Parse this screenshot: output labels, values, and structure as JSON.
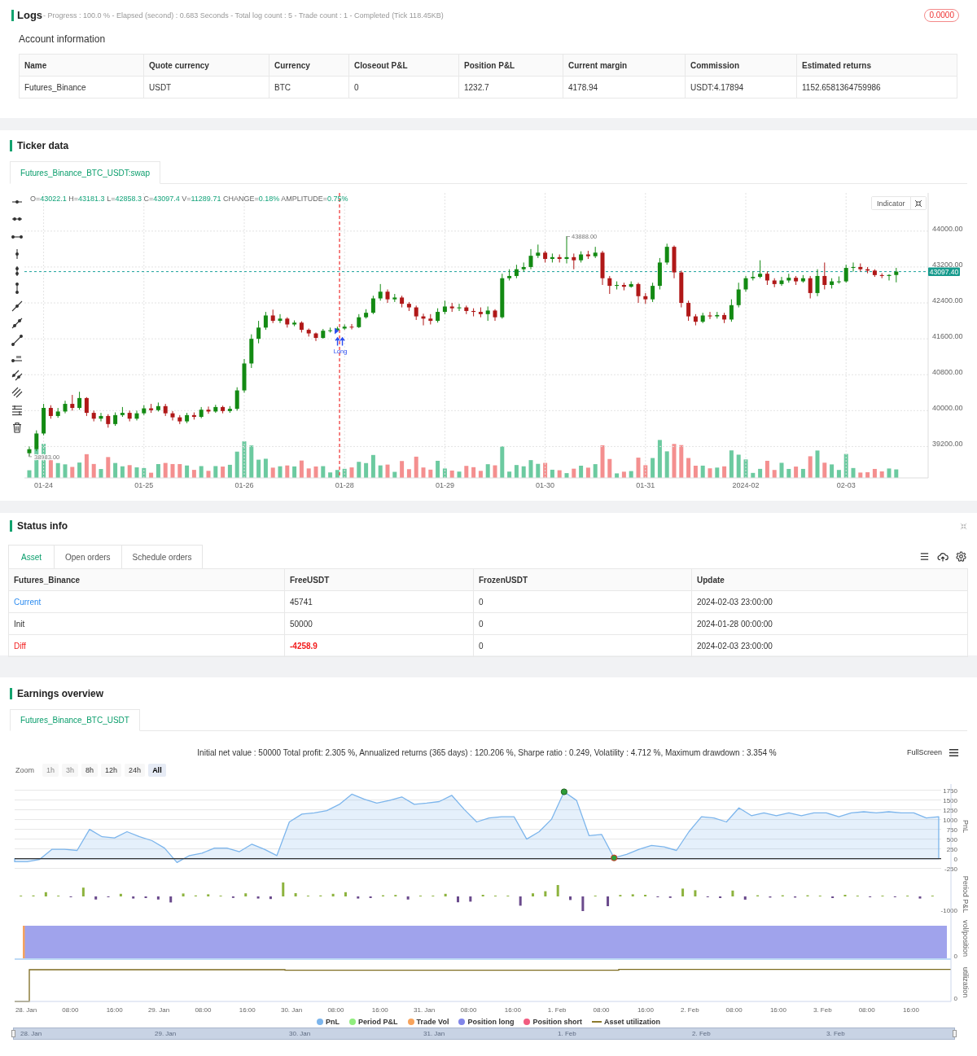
{
  "logs": {
    "title": "Logs",
    "summary": "- Progress : 100.0 % - Elapsed (second) : 0.683 Seconds - Total log count : 5 - Trade count : 1 - Completed (Tick 118.45KB)",
    "badge": "0.0000"
  },
  "account_information": {
    "title": "Account information",
    "columns": [
      "Name",
      "Quote currency",
      "Currency",
      "Closeout P&L",
      "Position P&L",
      "Current margin",
      "Commission",
      "Estimated returns"
    ],
    "rows": [
      [
        "Futures_Binance",
        "USDT",
        "BTC",
        "0",
        "1232.7",
        "4178.94",
        "USDT:4.17894",
        "1152.6581364759986"
      ]
    ]
  },
  "ticker_data": {
    "title": "Ticker data",
    "tabs": [
      {
        "label": "Futures_Binance_BTC_USDT:swap",
        "selected": true
      }
    ],
    "ohlc": [
      {
        "label": "O=",
        "value": "43022.1"
      },
      {
        "label": "H=",
        "value": "43181.3"
      },
      {
        "label": "L=",
        "value": "42858.3"
      },
      {
        "label": "C=",
        "value": "43097.4"
      },
      {
        "label": "V=",
        "value": "11289.71"
      },
      {
        "label": "CHANGE=",
        "value": "0.18%"
      },
      {
        "label": "AMPLITUDE=",
        "value": "0.75%"
      }
    ],
    "indicator_button": "Indicator",
    "last_price": "43097.40",
    "high_label": "43888.00",
    "low_label": "38983.00",
    "chart_data": {
      "type": "candlestick",
      "grid": true,
      "ylim": [
        38500,
        44850
      ],
      "yticks": [
        {
          "value": 44000,
          "label": "44000.00"
        },
        {
          "value": 43200,
          "label": "43200.00"
        },
        {
          "value": 42400,
          "label": "42400.00"
        },
        {
          "value": 41600,
          "label": "41600.00"
        },
        {
          "value": 40800,
          "label": "40800.00"
        },
        {
          "value": 40000,
          "label": "40000.00"
        },
        {
          "value": 39200,
          "label": "39200.00"
        }
      ],
      "categories": [
        null,
        null,
        "01-24",
        null,
        null,
        null,
        null,
        null,
        null,
        null,
        null,
        null,
        null,
        null,
        null,
        null,
        "01-25",
        null,
        null,
        null,
        null,
        null,
        null,
        null,
        null,
        null,
        null,
        null,
        null,
        null,
        "01-26",
        null,
        null,
        null,
        null,
        null,
        null,
        null,
        null,
        null,
        null,
        null,
        null,
        null,
        "01-28",
        null,
        null,
        null,
        null,
        null,
        null,
        null,
        null,
        null,
        null,
        null,
        null,
        null,
        "01-29",
        null,
        null,
        null,
        null,
        null,
        null,
        null,
        null,
        null,
        null,
        null,
        null,
        null,
        "01-30",
        null,
        null,
        null,
        null,
        null,
        null,
        null,
        null,
        null,
        null,
        null,
        null,
        null,
        "01-31",
        null,
        null,
        null,
        null,
        null,
        null,
        null,
        null,
        null,
        null,
        null,
        null,
        null,
        "2024-02",
        null,
        null,
        null,
        null,
        null,
        null,
        null,
        null,
        null,
        null,
        null,
        null,
        null,
        "02-03",
        null,
        null,
        null,
        null,
        null,
        null,
        null
      ],
      "annotations": [
        "Long"
      ],
      "ref_lines": [
        {
          "axis": "y",
          "value": 43097.4
        }
      ],
      "ohlc": [
        [
          39050,
          39200,
          38983,
          39140
        ],
        [
          39140,
          39560,
          39100,
          39490
        ],
        [
          39490,
          40150,
          39450,
          40060
        ],
        [
          40060,
          40120,
          39820,
          39880
        ],
        [
          39880,
          40060,
          39840,
          39980
        ],
        [
          39980,
          40220,
          39940,
          40150
        ],
        [
          40150,
          40350,
          40000,
          40060
        ],
        [
          40060,
          40420,
          40020,
          40280
        ],
        [
          40280,
          40300,
          39880,
          39950
        ],
        [
          39950,
          40000,
          39760,
          39820
        ],
        [
          39820,
          39950,
          39760,
          39880
        ],
        [
          39880,
          39920,
          39620,
          39700
        ],
        [
          39700,
          39960,
          39660,
          39900
        ],
        [
          39900,
          40080,
          39860,
          39950
        ],
        [
          39950,
          40000,
          39760,
          39820
        ],
        [
          39820,
          40000,
          39780,
          39940
        ],
        [
          39940,
          40120,
          39900,
          40050
        ],
        [
          40050,
          40150,
          39950,
          40010
        ],
        [
          40010,
          40180,
          39980,
          40100
        ],
        [
          40100,
          40150,
          39880,
          39940
        ],
        [
          39940,
          39990,
          39780,
          39850
        ],
        [
          39850,
          39900,
          39700,
          39760
        ],
        [
          39760,
          39950,
          39720,
          39900
        ],
        [
          39900,
          39960,
          39800,
          39860
        ],
        [
          39860,
          40080,
          39830,
          40020
        ],
        [
          40020,
          40090,
          39930,
          39980
        ],
        [
          39980,
          40130,
          39950,
          40080
        ],
        [
          40080,
          40110,
          39940,
          39990
        ],
        [
          39990,
          40100,
          39950,
          40040
        ],
        [
          40040,
          40520,
          40000,
          40450
        ],
        [
          40450,
          41150,
          40400,
          41050
        ],
        [
          41050,
          41700,
          40950,
          41600
        ],
        [
          41600,
          42000,
          41500,
          41850
        ],
        [
          41850,
          42200,
          41800,
          42120
        ],
        [
          42120,
          42250,
          41950,
          42000
        ],
        [
          42000,
          42150,
          41950,
          42050
        ],
        [
          42050,
          42080,
          41850,
          41920
        ],
        [
          41920,
          42010,
          41880,
          41960
        ],
        [
          41960,
          41990,
          41740,
          41800
        ],
        [
          41800,
          41830,
          41650,
          41720
        ],
        [
          41720,
          41740,
          41550,
          41620
        ],
        [
          41620,
          41820,
          41600,
          41780
        ],
        [
          41780,
          41850,
          41740,
          41790
        ],
        [
          41790,
          41870,
          41770,
          41830
        ],
        [
          41830,
          41920,
          41800,
          41870
        ],
        [
          41870,
          41930,
          41810,
          41860
        ],
        [
          41860,
          42150,
          41840,
          42080
        ],
        [
          42080,
          42260,
          42050,
          42180
        ],
        [
          42180,
          42560,
          42150,
          42500
        ],
        [
          42500,
          42820,
          42450,
          42650
        ],
        [
          42650,
          42700,
          42400,
          42480
        ],
        [
          42480,
          42600,
          42420,
          42520
        ],
        [
          42520,
          42560,
          42300,
          42380
        ],
        [
          42380,
          42420,
          42220,
          42300
        ],
        [
          42300,
          42340,
          42020,
          42100
        ],
        [
          42100,
          42160,
          41900,
          42050
        ],
        [
          42050,
          42150,
          41920,
          42000
        ],
        [
          42000,
          42280,
          41960,
          42200
        ],
        [
          42200,
          42450,
          42150,
          42320
        ],
        [
          42320,
          42400,
          42200,
          42280
        ],
        [
          42280,
          42380,
          42220,
          42300
        ],
        [
          42300,
          42340,
          42150,
          42220
        ],
        [
          42220,
          42280,
          42100,
          42200
        ],
        [
          42200,
          42300,
          42080,
          42150
        ],
        [
          42150,
          42320,
          42000,
          42230
        ],
        [
          42230,
          42260,
          42000,
          42080
        ],
        [
          42080,
          43050,
          42050,
          42950
        ],
        [
          42950,
          43150,
          42900,
          43000
        ],
        [
          43000,
          43250,
          42950,
          43150
        ],
        [
          43150,
          43300,
          43100,
          43200
        ],
        [
          43200,
          43600,
          43150,
          43450
        ],
        [
          43450,
          43700,
          43400,
          43520
        ],
        [
          43520,
          43560,
          43300,
          43380
        ],
        [
          43380,
          43500,
          43300,
          43420
        ],
        [
          43420,
          43480,
          43300,
          43380
        ],
        [
          43380,
          43888,
          43280,
          43420
        ],
        [
          43420,
          43500,
          43150,
          43350
        ],
        [
          43350,
          43550,
          43300,
          43480
        ],
        [
          43480,
          43560,
          43380,
          43440
        ],
        [
          43440,
          43650,
          43400,
          43520
        ],
        [
          43520,
          43560,
          42800,
          42950
        ],
        [
          42950,
          43000,
          42600,
          42780
        ],
        [
          42780,
          42880,
          42700,
          42800
        ],
        [
          42800,
          42850,
          42680,
          42760
        ],
        [
          42760,
          42880,
          42740,
          42820
        ],
        [
          42820,
          42850,
          42400,
          42550
        ],
        [
          42550,
          42620,
          42380,
          42480
        ],
        [
          42480,
          42850,
          42420,
          42780
        ],
        [
          42780,
          43400,
          42700,
          43300
        ],
        [
          43300,
          43720,
          43250,
          43650
        ],
        [
          43650,
          43680,
          42950,
          43080
        ],
        [
          43080,
          43120,
          42300,
          42400
        ],
        [
          42400,
          42450,
          42000,
          42100
        ],
        [
          42100,
          42150,
          41900,
          41980
        ],
        [
          41980,
          42180,
          41950,
          42120
        ],
        [
          42120,
          42200,
          42040,
          42100
        ],
        [
          42100,
          42200,
          42050,
          42130
        ],
        [
          42130,
          42180,
          41950,
          42030
        ],
        [
          42030,
          42480,
          41980,
          42350
        ],
        [
          42350,
          42850,
          42300,
          42700
        ],
        [
          42700,
          43000,
          42650,
          42950
        ],
        [
          42950,
          43100,
          42900,
          42980
        ],
        [
          42980,
          43350,
          42950,
          43050
        ],
        [
          43050,
          43100,
          42800,
          42900
        ],
        [
          42900,
          42950,
          42750,
          42820
        ],
        [
          42820,
          42980,
          42780,
          42900
        ],
        [
          42900,
          43050,
          42850,
          42960
        ],
        [
          42960,
          43000,
          42800,
          42880
        ],
        [
          42880,
          43020,
          42850,
          42950
        ],
        [
          42950,
          43000,
          42500,
          42620
        ],
        [
          42620,
          43150,
          42550,
          43000
        ],
        [
          43000,
          43300,
          42700,
          42800
        ],
        [
          42800,
          42950,
          42720,
          42880
        ],
        [
          42880,
          42990,
          42830,
          42880
        ],
        [
          42880,
          43250,
          42850,
          43180
        ],
        [
          43180,
          43300,
          43100,
          43200
        ],
        [
          43200,
          43280,
          43100,
          43150
        ],
        [
          43150,
          43200,
          43060,
          43120
        ],
        [
          43120,
          43150,
          42980,
          43020
        ],
        [
          43020,
          43060,
          42950,
          43000
        ],
        [
          43000,
          43040,
          42900,
          43022.1
        ],
        [
          43022.1,
          43181.3,
          42858.3,
          43097.4
        ]
      ]
    }
  },
  "status_info": {
    "title": "Status info",
    "tabs": [
      {
        "label": "Asset",
        "selected": true
      },
      {
        "label": "Open orders",
        "selected": false
      },
      {
        "label": "Schedule orders",
        "selected": false
      }
    ],
    "columns": [
      "Futures_Binance",
      "FreeUSDT",
      "FrozenUSDT",
      "Update"
    ],
    "rows": [
      {
        "kind": "link",
        "cells": [
          "Current",
          "45741",
          "0",
          "2024-02-03 23:00:00"
        ]
      },
      {
        "kind": "plain",
        "cells": [
          "Init",
          "50000",
          "0",
          "2024-01-28 00:00:00"
        ]
      },
      {
        "kind": "negative",
        "cells": [
          "Diff",
          "-4258.9",
          "0",
          "2024-02-03 23:00:00"
        ]
      }
    ]
  },
  "earnings_overview": {
    "title": "Earnings overview",
    "tabs": [
      {
        "label": "Futures_Binance_BTC_USDT",
        "selected": true
      }
    ],
    "summary": "Initial net value : 50000 Total profit: 2.305 %, Annualized returns (365 days) : 120.206 %, Sharpe ratio : 0.249, Volatility : 4.712 %, Maximum drawdown : 3.354 %",
    "fullscreen_button": "FullScreen",
    "zoom_label": "Zoom",
    "zoom_buttons": [
      {
        "label": "1h",
        "selected": false,
        "disabled": true
      },
      {
        "label": "3h",
        "selected": false,
        "disabled": true
      },
      {
        "label": "8h",
        "selected": false,
        "disabled": false
      },
      {
        "label": "12h",
        "selected": false,
        "disabled": false
      },
      {
        "label": "24h",
        "selected": false,
        "disabled": false
      },
      {
        "label": "All",
        "selected": true,
        "disabled": false
      }
    ],
    "chart_data": {
      "type": "area",
      "grid": true,
      "ylabel": "PnL",
      "ylim": [
        -250,
        1750
      ],
      "yticks": [
        -250,
        0,
        250,
        500,
        750,
        1000,
        1250,
        1500,
        1750
      ],
      "series": [
        {
          "name": "PnL",
          "color": "#7cb5ec",
          "values": [
            -80,
            -80,
            -20,
            240,
            240,
            210,
            750,
            560,
            530,
            690,
            560,
            460,
            270,
            -100,
            80,
            140,
            270,
            270,
            180,
            370,
            240,
            80,
            940,
            1140,
            1170,
            1230,
            1390,
            1650,
            1520,
            1420,
            1490,
            1580,
            1390,
            1420,
            1460,
            1620,
            1260,
            940,
            1040,
            1070,
            1070,
            500,
            690,
            1010,
            1710,
            1490,
            590,
            620,
            20,
            110,
            240,
            340,
            300,
            210,
            690,
            1070,
            1040,
            940,
            1300,
            1100,
            1170,
            1100,
            1170,
            1100,
            1170,
            1170,
            1070,
            1170,
            1200,
            1170,
            1200,
            1170,
            1170,
            1040,
            1070
          ]
        }
      ]
    },
    "panes": [
      {
        "kind": "bars",
        "label": "Period P&L",
        "ticks": [
          "-1000"
        ]
      },
      {
        "kind": "position",
        "label": "vol/position",
        "ticks": [
          "0"
        ]
      },
      {
        "kind": "utilization",
        "label": "utilization",
        "ticks": [
          "0"
        ]
      }
    ],
    "x_axis_labels": [
      "28. Jan",
      "08:00",
      "16:00",
      "29. Jan",
      "08:00",
      "16:00",
      "30. Jan",
      "08:00",
      "16:00",
      "31. Jan",
      "08:00",
      "16:00",
      "1. Feb",
      "08:00",
      "16:00",
      "2. Feb",
      "08:00",
      "16:00",
      "3. Feb",
      "08:00",
      "16:00"
    ],
    "legend": [
      {
        "label": "Period P&L",
        "kind": "dot",
        "color": "#90ed7d"
      },
      {
        "label": "Trade Vol",
        "kind": "dot",
        "color": "#f7a35c"
      },
      {
        "label": "Position long",
        "kind": "dot",
        "color": "#8085e9"
      },
      {
        "label": "Position short",
        "kind": "dot",
        "color": "#f15c80"
      },
      {
        "label": "Asset utilization",
        "kind": "line",
        "color": "#8c7a2c"
      }
    ],
    "navigator_labels": [
      "28. Jan",
      "29. Jan",
      "30. Jan",
      "31. Jan",
      "1. Feb",
      "2. Feb",
      "3. Feb"
    ]
  }
}
